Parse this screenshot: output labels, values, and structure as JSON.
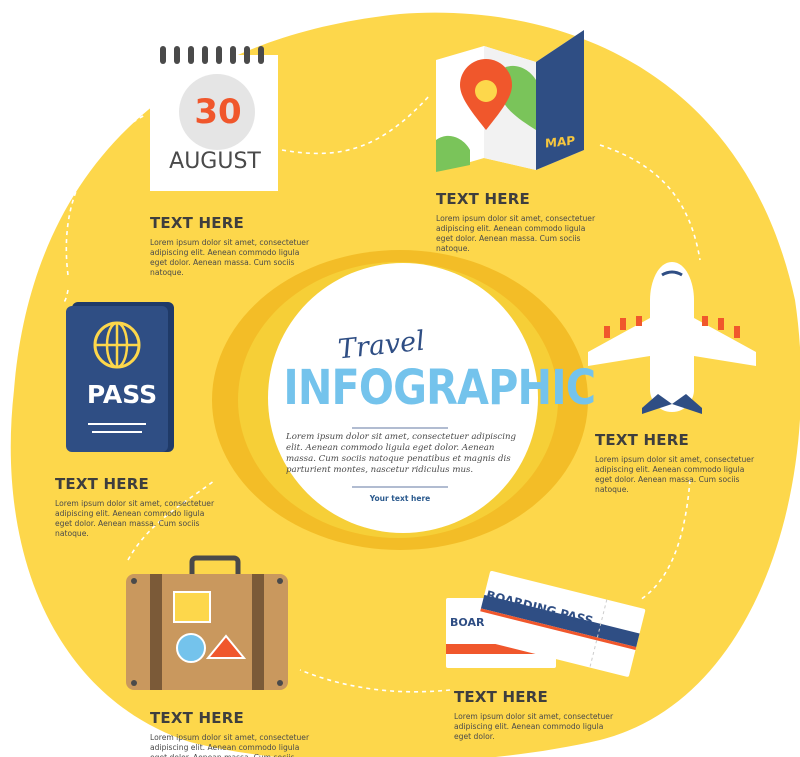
{
  "center": {
    "title_script": "Travel",
    "title_main": "INFOGRAPHIC",
    "body": "Lorem ipsum dolor sit amet, consectetuer adipiscing elit. Aenean commodo ligula eget dolor. Aenean massa. Cum sociis natoque penatibus et magnis dis parturient montes, nascetur ridiculus mus.",
    "link": "Your text here"
  },
  "items": [
    {
      "heading": "TEXT HERE",
      "body": "Lorem ipsum dolor sit amet, consectetuer adipiscing elit. Aenean commodo ligula eget dolor. Aenean massa. Cum sociis natoque."
    },
    {
      "heading": "TEXT HERE",
      "body": "Lorem ipsum dolor sit amet, consectetuer adipiscing elit. Aenean commodo ligula eget dolor. Aenean massa. Cum sociis natoque."
    },
    {
      "heading": "TEXT HERE",
      "body": "Lorem ipsum dolor sit amet, consectetuer adipiscing elit. Aenean commodo ligula eget dolor. Aenean massa. Cum sociis natoque."
    },
    {
      "heading": "TEXT HERE",
      "body": "Lorem ipsum dolor sit amet, consectetuer adipiscing elit. Aenean commodo ligula eget dolor. Aenean massa. Cum sociis natoque."
    },
    {
      "heading": "TEXT HERE",
      "body": "Lorem ipsum dolor sit amet, consectetuer adipiscing elit. Aenean commodo ligula eget dolor. Aenean massa. Cum sociis natoque."
    },
    {
      "heading": "TEXT HERE",
      "body": "Lorem ipsum dolor sit amet, consectetuer adipiscing elit. Aenean commodo ligula eget dolor."
    }
  ],
  "icons": {
    "calendar": {
      "icon": "calendar-icon",
      "day": "30",
      "month": "AUGUST"
    },
    "map": {
      "icon": "map-icon",
      "label": "MAP"
    },
    "airplane": {
      "icon": "airplane-icon"
    },
    "passport": {
      "icon": "passport-icon",
      "label": "PASS"
    },
    "suitcase": {
      "icon": "suitcase-icon"
    },
    "boarding_pass": {
      "icon": "boarding-pass-icon",
      "label": "BOARDING PASS",
      "back_label": "BOAR"
    }
  },
  "colors": {
    "background_yellow": "#fdd74b",
    "ring_yellow": "#f3bd27",
    "navy": "#2f4e84",
    "sky_blue": "#74c3ec",
    "orange": "#f0572c",
    "text_dark": "#3e3e3e"
  }
}
